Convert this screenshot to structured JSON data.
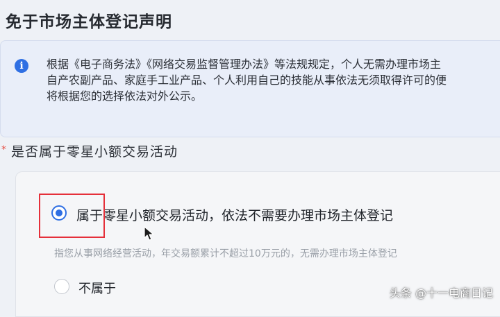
{
  "header": {
    "title": "免于市场主体登记声明"
  },
  "notice": {
    "icon": "info-icon",
    "icon_glyph": "i",
    "lines": [
      "根据《电子商务法》《网络交易监督管理办法》等法规规定，个人无需办理市场主",
      "自产农副产品、家庭手工业产品、个人利用自己的技能从事依法无须取得许可的便",
      "将根据您的选择依法对外公示。"
    ]
  },
  "section": {
    "required_marker": "*",
    "title": "是否属于零星小额交易活动"
  },
  "options": [
    {
      "label": "属于零星小额交易活动，依法不需要办理市场主体登记",
      "description": "指您从事网络经营活动，年交易额累计不超过10万元的，无需办理市场主体登记",
      "selected": true
    },
    {
      "label": "不属于",
      "selected": false
    }
  ],
  "watermark": {
    "text": "头条 @十一电商日记"
  },
  "colors": {
    "accent": "#2f6fe3",
    "highlight": "#e5303a",
    "notice_bg": "#e9eef9"
  }
}
